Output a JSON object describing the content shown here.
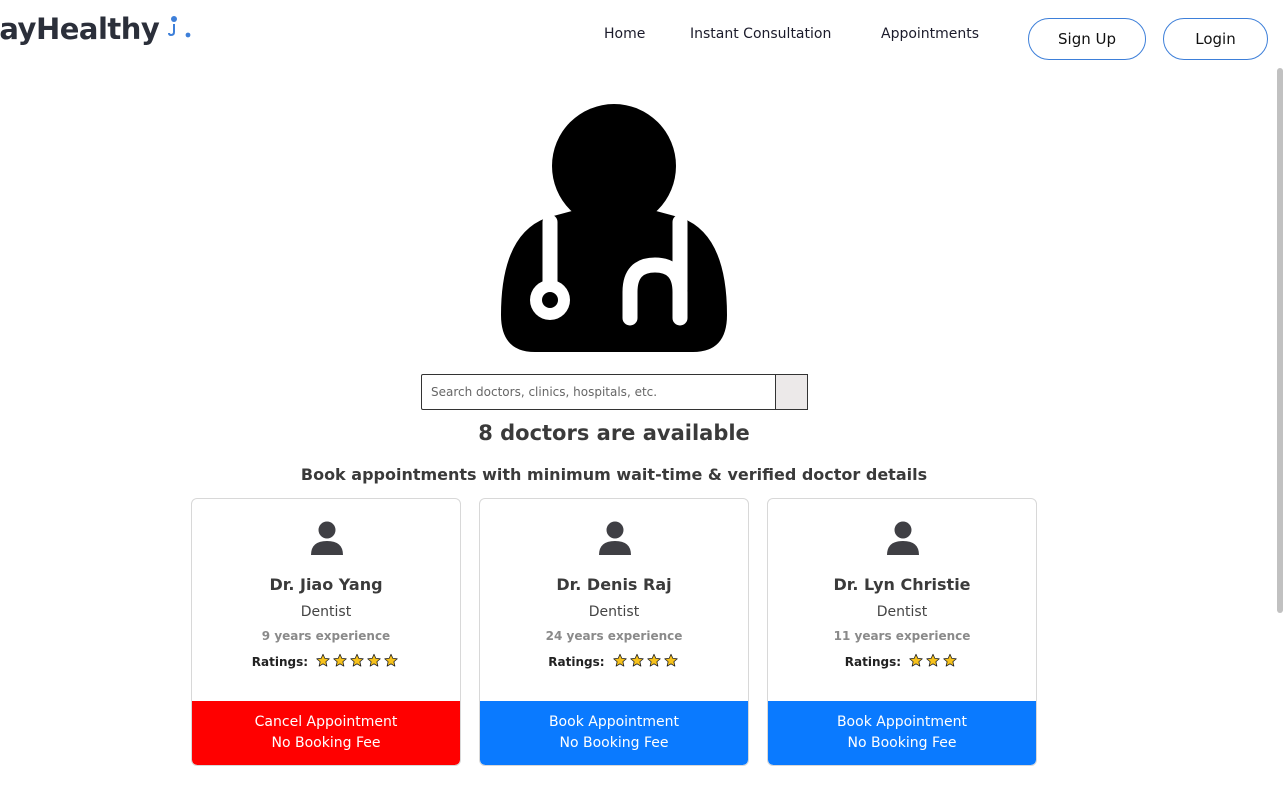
{
  "navbar": {
    "logo_text": "tayHealthy",
    "links": [
      "Home",
      "Instant Consultation",
      "Appointments"
    ],
    "signup_label": "Sign Up",
    "login_label": "Login"
  },
  "search": {
    "placeholder": "Search doctors, clinics, hospitals, etc.",
    "value": ""
  },
  "headline": "8 doctors are available",
  "subtitle": "Book appointments with minimum wait-time & verified doctor details",
  "ratings_label": "Ratings:",
  "doctors": [
    {
      "name": "Dr. Jiao Yang",
      "speciality": "Dentist",
      "experience": "9 years experience",
      "rating": 5,
      "button_line1": "Cancel Appointment",
      "button_line2": "No Booking Fee",
      "button_color": "#ff0000"
    },
    {
      "name": "Dr. Denis Raj",
      "speciality": "Dentist",
      "experience": "24 years experience",
      "rating": 4,
      "button_line1": "Book Appointment",
      "button_line2": "No Booking Fee",
      "button_color": "#0a7aff"
    },
    {
      "name": "Dr. Lyn Christie",
      "speciality": "Dentist",
      "experience": "11 years experience",
      "rating": 3,
      "button_line1": "Book Appointment",
      "button_line2": "No Booking Fee",
      "button_color": "#0a7aff"
    }
  ],
  "colors": {
    "accent": "#3d7fd9",
    "star_fill": "#f7c21c",
    "cancel": "#ff0000",
    "book": "#0a7aff"
  },
  "icons": {
    "logo": "person-stethoscope-icon",
    "hero": "doctor-stethoscope-icon",
    "avatar": "person-icon",
    "star": "star-icon"
  }
}
